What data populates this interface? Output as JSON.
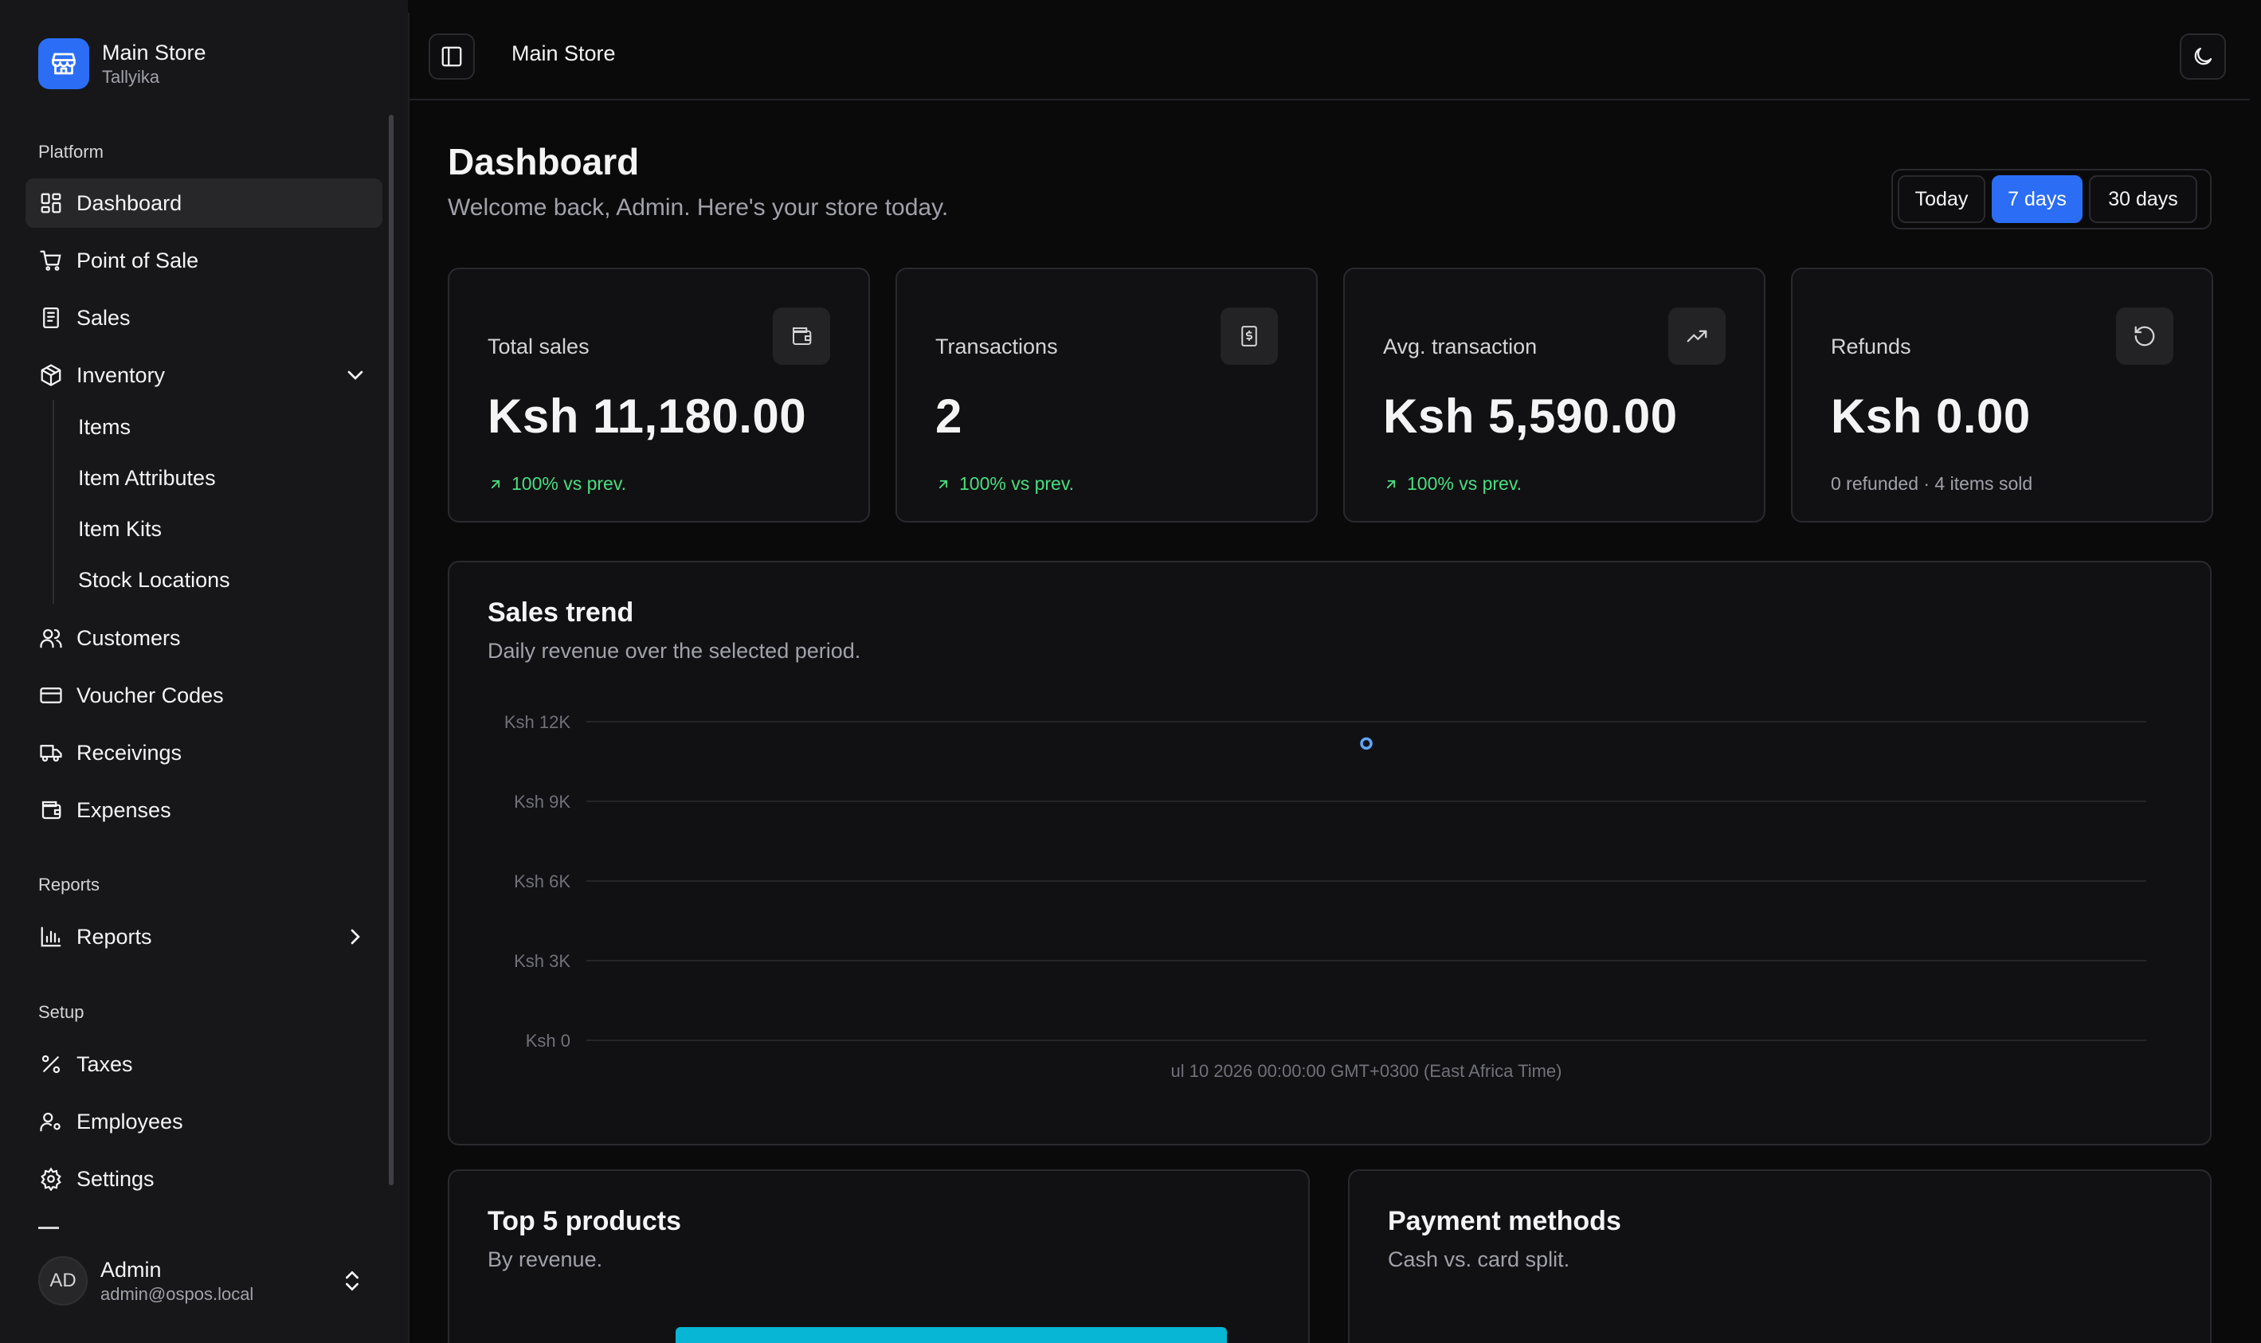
{
  "sidebar": {
    "brand": {
      "title": "Main Store",
      "subtitle": "Tallyika"
    },
    "groups": {
      "platform": "Platform",
      "reports": "Reports",
      "setup": "Setup"
    },
    "items": {
      "dashboard": "Dashboard",
      "pos": "Point of Sale",
      "sales": "Sales",
      "inventory": "Inventory",
      "customers": "Customers",
      "vouchers": "Voucher Codes",
      "receivings": "Receivings",
      "expenses": "Expenses",
      "reports": "Reports",
      "taxes": "Taxes",
      "employees": "Employees",
      "settings": "Settings"
    },
    "inventory_sub": [
      "Items",
      "Item Attributes",
      "Item Kits",
      "Stock Locations"
    ],
    "user": {
      "initials": "AD",
      "name": "Admin",
      "email": "admin@ospos.local"
    }
  },
  "topbar": {
    "title": "Main Store"
  },
  "header": {
    "title": "Dashboard",
    "subtitle": "Welcome back, Admin. Here's your store today.",
    "ranges": [
      "Today",
      "7 days",
      "30 days"
    ],
    "selected_range": "7 days"
  },
  "stats": [
    {
      "label": "Total sales",
      "value": "Ksh 11,180.00",
      "delta": "100% vs prev.",
      "icon": "wallet-icon"
    },
    {
      "label": "Transactions",
      "value": "2",
      "delta": "100% vs prev.",
      "icon": "receipt-icon"
    },
    {
      "label": "Avg. transaction",
      "value": "Ksh 5,590.00",
      "delta": "100% vs prev.",
      "icon": "trending-up-icon"
    },
    {
      "label": "Refunds",
      "value": "Ksh 0.00",
      "delta": "0 refunded · 4 items sold",
      "icon": "rotate-ccw-icon"
    }
  ],
  "sales_trend": {
    "title": "Sales trend",
    "subtitle": "Daily revenue over the selected period."
  },
  "chart_data": {
    "type": "line",
    "x": [
      "ul 10 2026 00:00:00 GMT+0300 (East Africa Time)"
    ],
    "series": [
      {
        "values": [
          11180
        ]
      }
    ],
    "ylim": [
      0,
      12000
    ],
    "yticks": [
      "Ksh 0",
      "Ksh 3K",
      "Ksh 6K",
      "Ksh 9K",
      "Ksh 12K"
    ],
    "grid": true,
    "point_color": "#60a5fa"
  },
  "top_products": {
    "title": "Top 5 products",
    "subtitle": "By revenue.",
    "bar_color": "#06b6d4"
  },
  "payment_methods": {
    "title": "Payment methods",
    "subtitle": "Cash vs. card split."
  },
  "colors": {
    "accent": "#2b6ef5",
    "positive": "#4ade80"
  }
}
